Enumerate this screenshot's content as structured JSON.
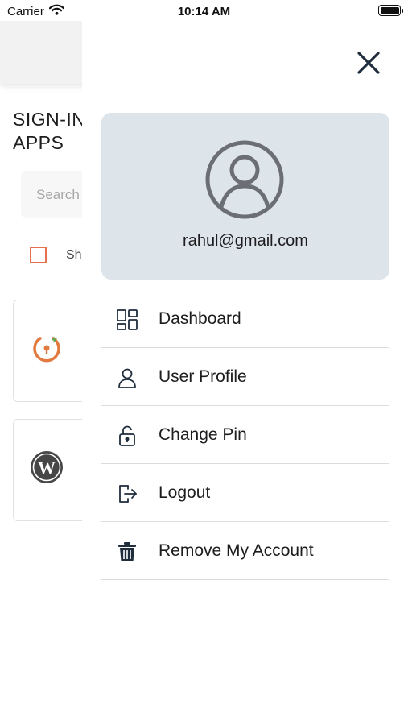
{
  "status_bar": {
    "carrier": "Carrier",
    "time": "10:14 AM"
  },
  "background_page": {
    "title_line1": "SIGN-IN",
    "title_line2": "APPS",
    "search_placeholder": "Search",
    "checkbox_label": "Sh"
  },
  "drawer": {
    "email": "rahul@gmail.com",
    "menu": [
      {
        "label": "Dashboard",
        "icon": "dashboard-icon"
      },
      {
        "label": "User Profile",
        "icon": "user-icon"
      },
      {
        "label": "Change Pin",
        "icon": "unlock-icon"
      },
      {
        "label": "Logout",
        "icon": "logout-icon"
      },
      {
        "label": "Remove My Account",
        "icon": "trash-icon"
      }
    ]
  },
  "colors": {
    "profile_card_bg": "#dde4ea",
    "checkbox_accent": "#e8704f",
    "app_icon_orange": "#e27a3f",
    "app_icon_green": "#4caf50"
  }
}
